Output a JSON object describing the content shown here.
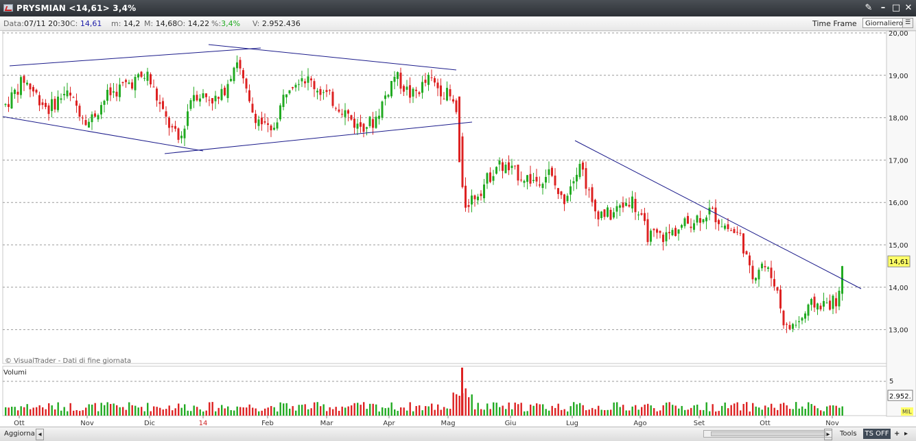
{
  "window": {
    "title": "PRYSMIAN <14,61> 3,4%",
    "tools_icon": "wrench-icon",
    "min_icon": "minimize-icon",
    "max_icon": "maximize-icon",
    "close_icon": "close-icon"
  },
  "info": {
    "data_label": "Data:",
    "data_value": "07/11 20:30",
    "c_label": "C:",
    "c_value": "14,61",
    "m_label": "m:",
    "m_value": "14,2",
    "M_label": "M:",
    "M_value": "14,68",
    "o_label": "O:",
    "o_value": "14,22",
    "pct_label": "%:",
    "pct_value": "3,4%",
    "v_label": "V:",
    "v_value": "2.952.436",
    "time_frame_label": "Time Frame",
    "time_frame_value": "Giornaliero"
  },
  "chart_data": {
    "type": "candlestick",
    "instrument": "PRYSMIAN",
    "y_ticks": [
      "20,00",
      "19,00",
      "18,00",
      "17,00",
      "16,00",
      "15,00",
      "14,00",
      "13,00"
    ],
    "ylim": [
      12.0,
      20.0
    ],
    "last_price_label": "14,61",
    "x_months": [
      "Ott",
      "Nov",
      "Dic",
      "14",
      "Feb",
      "Mar",
      "Apr",
      "Mag",
      "Giu",
      "Lug",
      "Ago",
      "Set",
      "Ott",
      "Nov"
    ],
    "volume_panel_label": "Volumi",
    "volume_tick": "5",
    "volume_last_label": "2.952.",
    "volume_unit": "MIL",
    "watermark": "© VisualTrader - Dati di fine giornata",
    "trend_lines": [
      {
        "from": [
          "Ott",
          19.1
        ],
        "to": [
          "Apr",
          19.1
        ]
      },
      {
        "from": [
          "Ott",
          17.9
        ],
        "to": [
          "Dic",
          17.2
        ]
      },
      {
        "from": [
          "Dic",
          17.15
        ],
        "to": [
          "Mag",
          17.85
        ]
      },
      {
        "from": [
          "Lug",
          17.45
        ],
        "to": [
          "Nov",
          13.95
        ]
      }
    ],
    "colors": {
      "up": "#22aa22",
      "down": "#dd2222",
      "trend": "#1a1a8a",
      "grid": "#9a9a9a"
    }
  },
  "bottom": {
    "aggiorna_label": "Aggiorna",
    "tools_label": "Tools",
    "ts_off_label": "TS OFF"
  }
}
